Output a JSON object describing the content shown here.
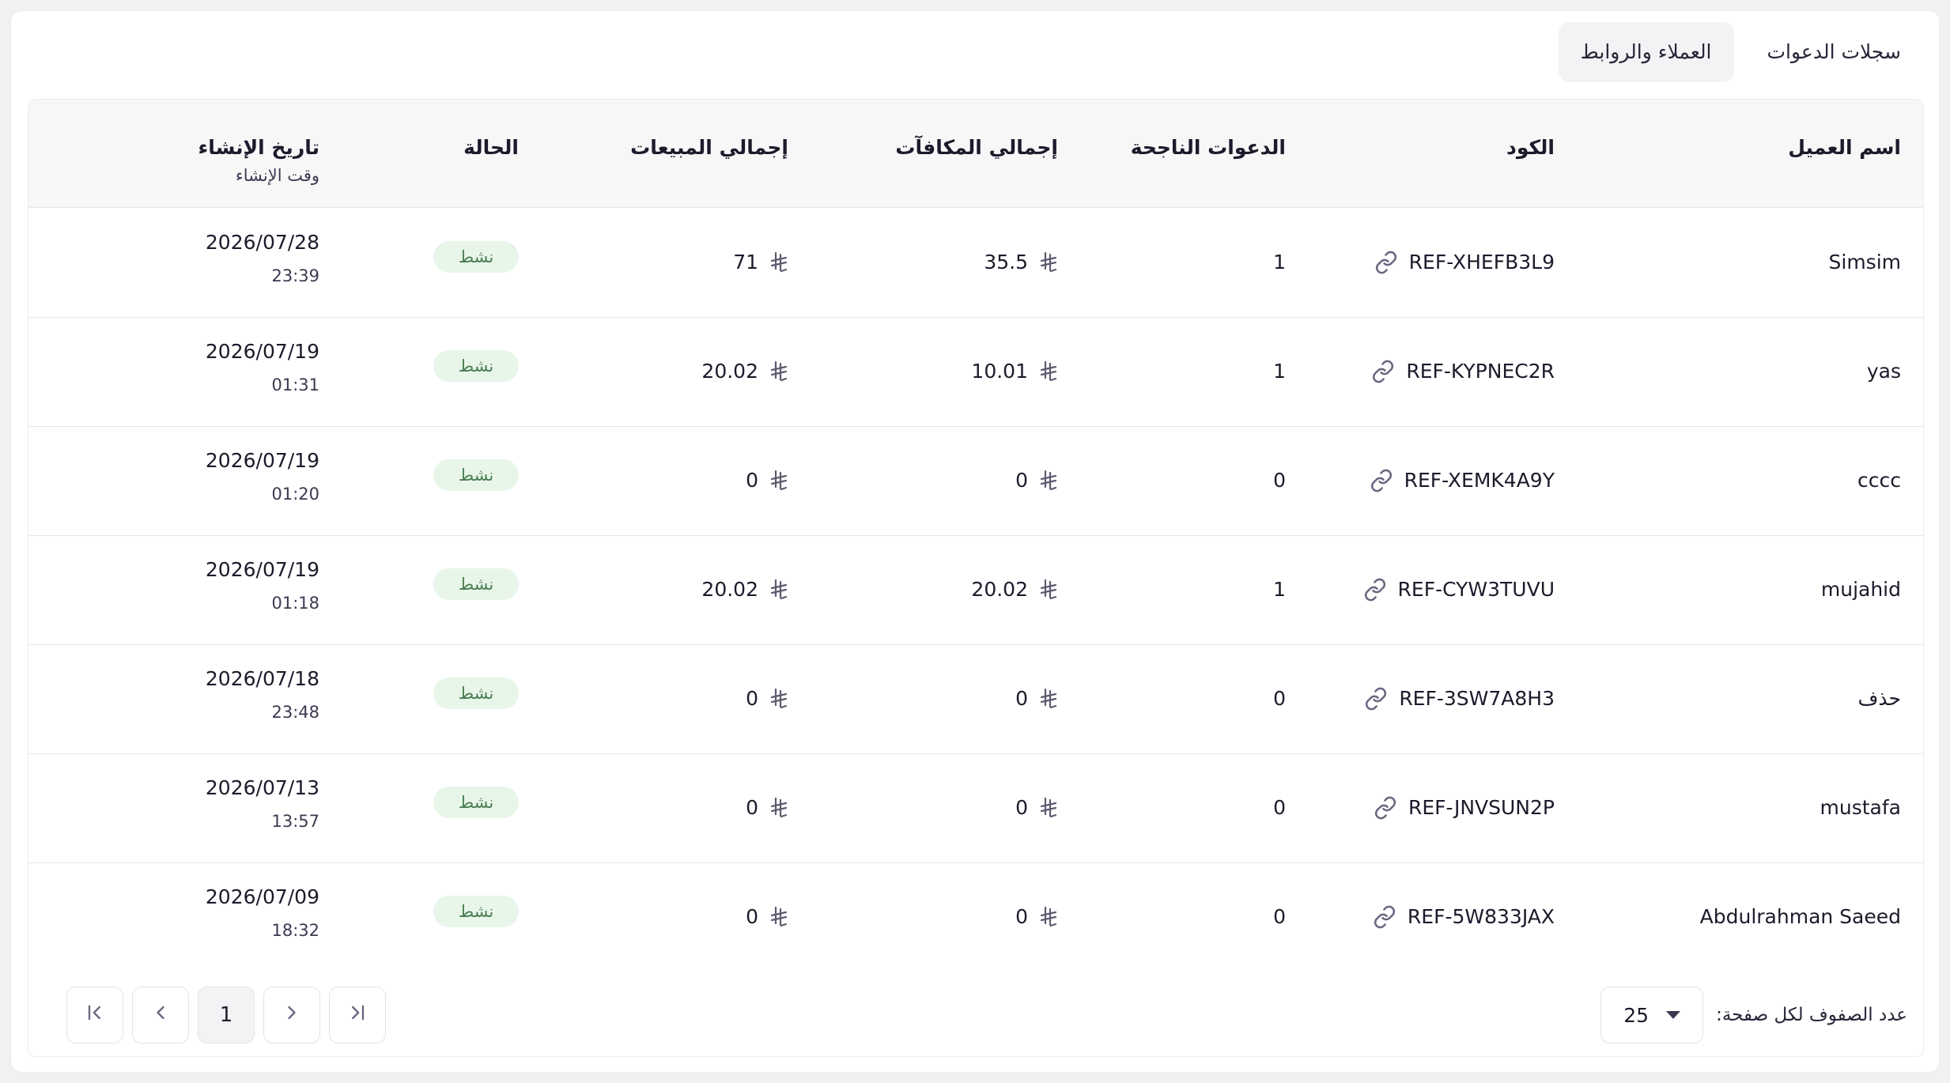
{
  "tabs": [
    {
      "label": "سجلات الدعوات",
      "active": false
    },
    {
      "label": "العملاء والروابط",
      "active": true
    }
  ],
  "table": {
    "headers": {
      "customer": "اسم العميل",
      "code": "الكود",
      "successful_invites": "الدعوات الناجحة",
      "total_rewards": "إجمالي المكافآت",
      "total_sales": "إجمالي المبيعات",
      "status": "الحالة",
      "created_date": "تاريخ الإنشاء",
      "created_time": "وقت الإنشاء"
    },
    "rows": [
      {
        "customer": "Simsim",
        "code": "REF-XHEFB3L9",
        "invites": "1",
        "rewards": "35.5",
        "sales": "71",
        "status": "نشط",
        "date": "2026/07/28",
        "time": "23:39"
      },
      {
        "customer": "yas",
        "code": "REF-KYPNEC2R",
        "invites": "1",
        "rewards": "10.01",
        "sales": "20.02",
        "status": "نشط",
        "date": "2026/07/19",
        "time": "01:31"
      },
      {
        "customer": "cccc",
        "code": "REF-XEMK4A9Y",
        "invites": "0",
        "rewards": "0",
        "sales": "0",
        "status": "نشط",
        "date": "2026/07/19",
        "time": "01:20"
      },
      {
        "customer": "mujahid",
        "code": "REF-CYW3TUVU",
        "invites": "1",
        "rewards": "20.02",
        "sales": "20.02",
        "status": "نشط",
        "date": "2026/07/19",
        "time": "01:18"
      },
      {
        "customer": "حذف",
        "code": "REF-3SW7A8H3",
        "invites": "0",
        "rewards": "0",
        "sales": "0",
        "status": "نشط",
        "date": "2026/07/18",
        "time": "23:48"
      },
      {
        "customer": "mustafa",
        "code": "REF-JNVSUN2P",
        "invites": "0",
        "rewards": "0",
        "sales": "0",
        "status": "نشط",
        "date": "2026/07/13",
        "time": "13:57"
      },
      {
        "customer": "Abdulrahman Saeed",
        "code": "REF-5W833JAX",
        "invites": "0",
        "rewards": "0",
        "sales": "0",
        "status": "نشط",
        "date": "2026/07/09",
        "time": "18:32"
      }
    ]
  },
  "pagination": {
    "rows_per_page_label": "عدد الصفوف لكل صفحة:",
    "rows_per_page": "25",
    "current_page": "1"
  },
  "colors": {
    "active_badge_bg": "#e8f6e9",
    "active_badge_text": "#4a7d52",
    "header_bg": "#f7f7f8"
  }
}
